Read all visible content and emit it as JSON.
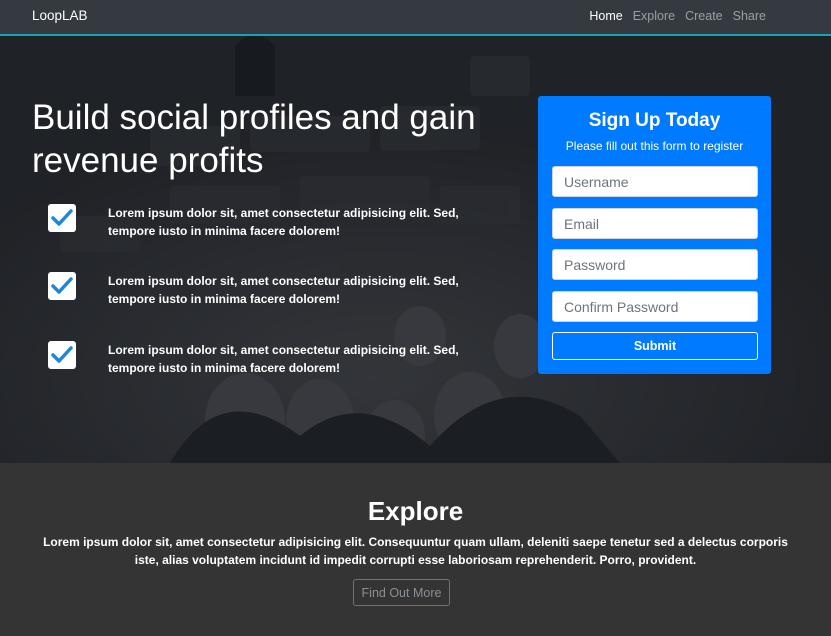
{
  "navbar": {
    "brand": "LoopLAB",
    "links": [
      {
        "label": "Home"
      },
      {
        "label": "Explore"
      },
      {
        "label": "Create"
      },
      {
        "label": "Share"
      }
    ]
  },
  "hero": {
    "title": "Build social profiles and gain revenue profits",
    "features": [
      {
        "icon": "check-icon",
        "text": "Lorem ipsum dolor sit, amet consectetur adipisicing elit. Sed, tempore iusto in minima facere dolorem!"
      },
      {
        "icon": "check-icon",
        "text": "Lorem ipsum dolor sit, amet consectetur adipisicing elit. Sed, tempore iusto in minima facere dolorem!"
      },
      {
        "icon": "check-icon",
        "text": "Lorem ipsum dolor sit, amet consectetur adipisicing elit. Sed, tempore iusto in minima facere dolorem!"
      }
    ]
  },
  "signup": {
    "title": "Sign Up Today",
    "subtitle": "Please fill out this form to register",
    "username_placeholder": "Username",
    "email_placeholder": "Email",
    "password_placeholder": "Password",
    "confirm_placeholder": "Confirm Password",
    "submit_label": "Submit"
  },
  "explore": {
    "title": "Explore",
    "text": "Lorem ipsum dolor sit, amet consectetur adipisicing elit. Consequuntur quam ullam, deleniti saepe tenetur sed a delectus corporis iste, alias voluptatem incidunt id impedit corrupti esse laboriosam reprehenderit. Porro, provident.",
    "button_label": "Find Out More"
  },
  "colors": {
    "primary": "#007bff",
    "navbar": "#343a40",
    "navbar_border": "#17a2b8",
    "check": "#1e88d8"
  }
}
